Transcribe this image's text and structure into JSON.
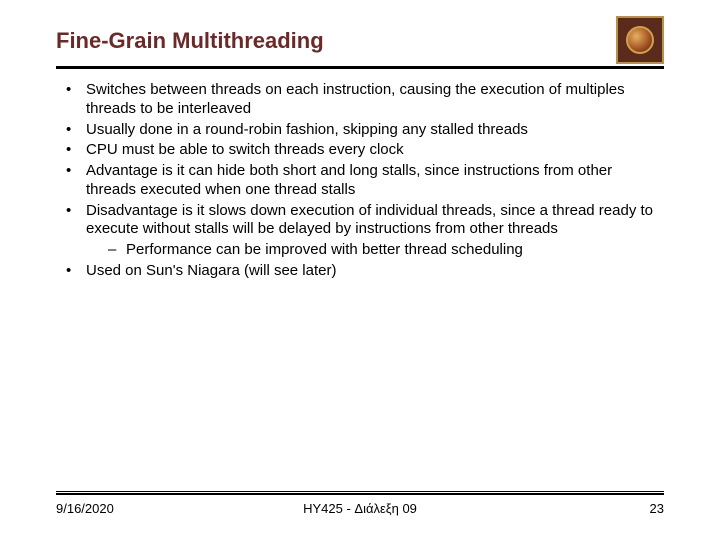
{
  "header": {
    "title": "Fine-Grain Multithreading"
  },
  "bullets": [
    "Switches between threads on each instruction, causing the execution of multiples threads to be interleaved",
    "Usually done in a round-robin fashion, skipping any stalled threads",
    "CPU must be able to switch threads every clock",
    "Advantage is it can hide both short and long stalls, since instructions from other threads executed when one thread stalls",
    "Disadvantage is it slows down execution of individual threads, since a thread ready to execute without stalls will be delayed by instructions from other threads",
    "Used on Sun's Niagara (will see later)"
  ],
  "subbullet": "Performance can be improved with better thread scheduling",
  "footer": {
    "date": "9/16/2020",
    "course": "HY425 - Διάλεξη 09",
    "page": "23"
  }
}
